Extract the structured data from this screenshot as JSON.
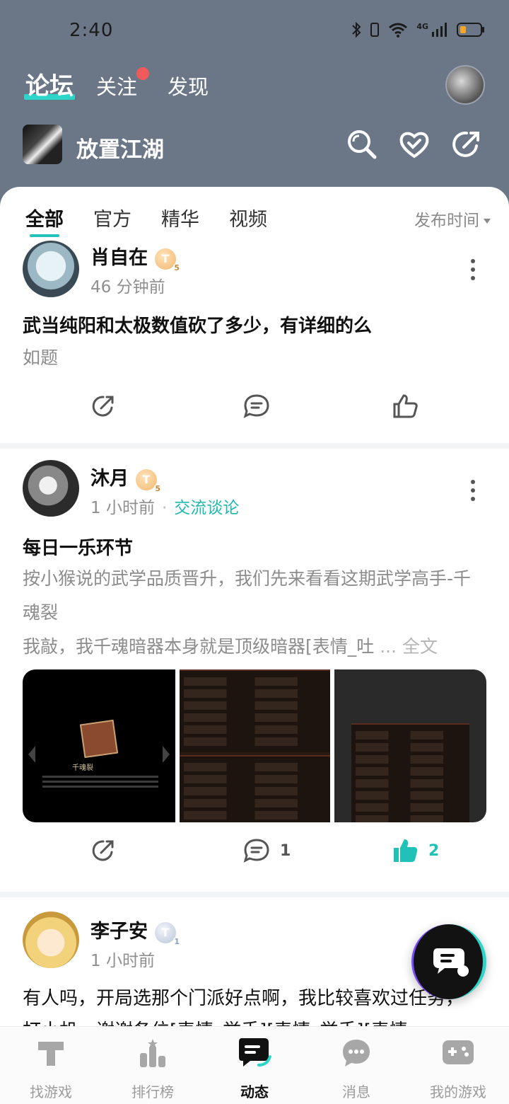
{
  "status": {
    "time": "2:40",
    "network": "4G"
  },
  "nav": {
    "tabs": [
      "论坛",
      "关注",
      "发现"
    ]
  },
  "game": {
    "title": "放置江湖"
  },
  "filters": {
    "tabs": [
      "全部",
      "官方",
      "精华",
      "视频"
    ],
    "sort": "发布时间"
  },
  "posts": [
    {
      "user": "肖自在",
      "badge": "T",
      "badge_level": "5",
      "time": "46 分钟前",
      "title": "武当纯阳和太极数值砍了多少，有详细的么",
      "body": "如题"
    },
    {
      "user": "沐月",
      "badge": "T",
      "badge_level": "5",
      "time": "1 小时前",
      "topic": "交流谈论",
      "title": "每日一乐环节",
      "body1": "按小猴说的武学品质晋升，我们先来看看这期武学高手-千魂裂",
      "body2": "我敲，我千魂暗器本身就是顶级暗器[表情_吐",
      "more": "... 全文",
      "image_text": "千魂裂",
      "comments": "1",
      "likes": "2"
    },
    {
      "user": "李子安",
      "badge": "T",
      "badge_level": "1",
      "time": "1 小时前",
      "body": "有人吗，开局选那个门派好点啊，我比较喜欢过任务，打小机，谢谢各位[表情_举手][表情_举手][表情"
    }
  ],
  "bottom": {
    "items": [
      "找游戏",
      "排行榜",
      "动态",
      "消息",
      "我的游戏"
    ]
  },
  "colors": {
    "accent": "#22c3bb",
    "header_bg": "#6b7687",
    "notice_dot": "#f05a5a"
  }
}
